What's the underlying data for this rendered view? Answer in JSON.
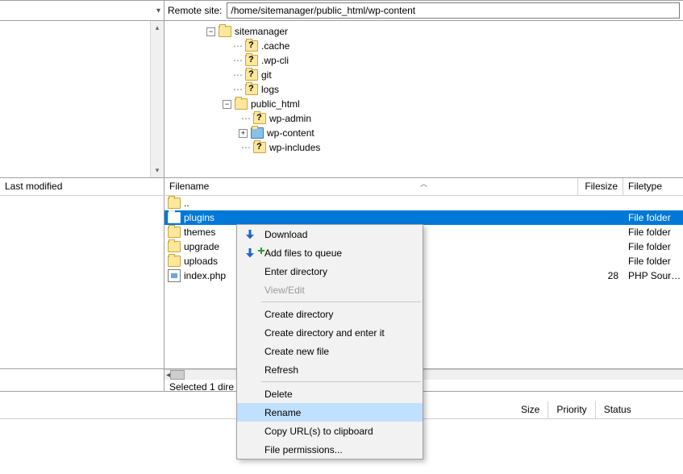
{
  "remote_site": {
    "label": "Remote site:",
    "path": "/home/sitemanager/public_html/wp-content"
  },
  "tree": {
    "root": "sitemanager",
    "children": [
      ".cache",
      ".wp-cli",
      "git",
      "logs"
    ],
    "public_html": "public_html",
    "ph_children": [
      "wp-admin",
      "wp-content",
      "wp-includes"
    ]
  },
  "file_headers": {
    "filename": "Filename",
    "filesize": "Filesize",
    "filetype": "Filetype",
    "last_modified": "Last modified"
  },
  "files": {
    "up": "..",
    "rows": [
      {
        "name": "plugins",
        "size": "",
        "type": "File folder",
        "icon": "folder",
        "selected": true
      },
      {
        "name": "themes",
        "size": "",
        "type": "File folder",
        "icon": "folder"
      },
      {
        "name": "upgrade",
        "size": "",
        "type": "File folder",
        "icon": "folder"
      },
      {
        "name": "uploads",
        "size": "",
        "type": "File folder",
        "icon": "folder"
      },
      {
        "name": "index.php",
        "size": "28",
        "type": "PHP Sourc...",
        "icon": "php"
      }
    ]
  },
  "status": "Selected 1 dire",
  "context_menu": {
    "items": [
      {
        "label": "Download",
        "icon": "download"
      },
      {
        "label": "Add files to queue",
        "icon": "queue"
      },
      {
        "label": "Enter directory"
      },
      {
        "label": "View/Edit",
        "disabled": true
      },
      {
        "sep": true
      },
      {
        "label": "Create directory"
      },
      {
        "label": "Create directory and enter it"
      },
      {
        "label": "Create new file"
      },
      {
        "label": "Refresh"
      },
      {
        "sep": true
      },
      {
        "label": "Delete"
      },
      {
        "label": "Rename",
        "hover": true
      },
      {
        "label": "Copy URL(s) to clipboard"
      },
      {
        "label": "File permissions..."
      }
    ]
  },
  "bottom_headers": [
    "Size",
    "Priority",
    "Status"
  ]
}
